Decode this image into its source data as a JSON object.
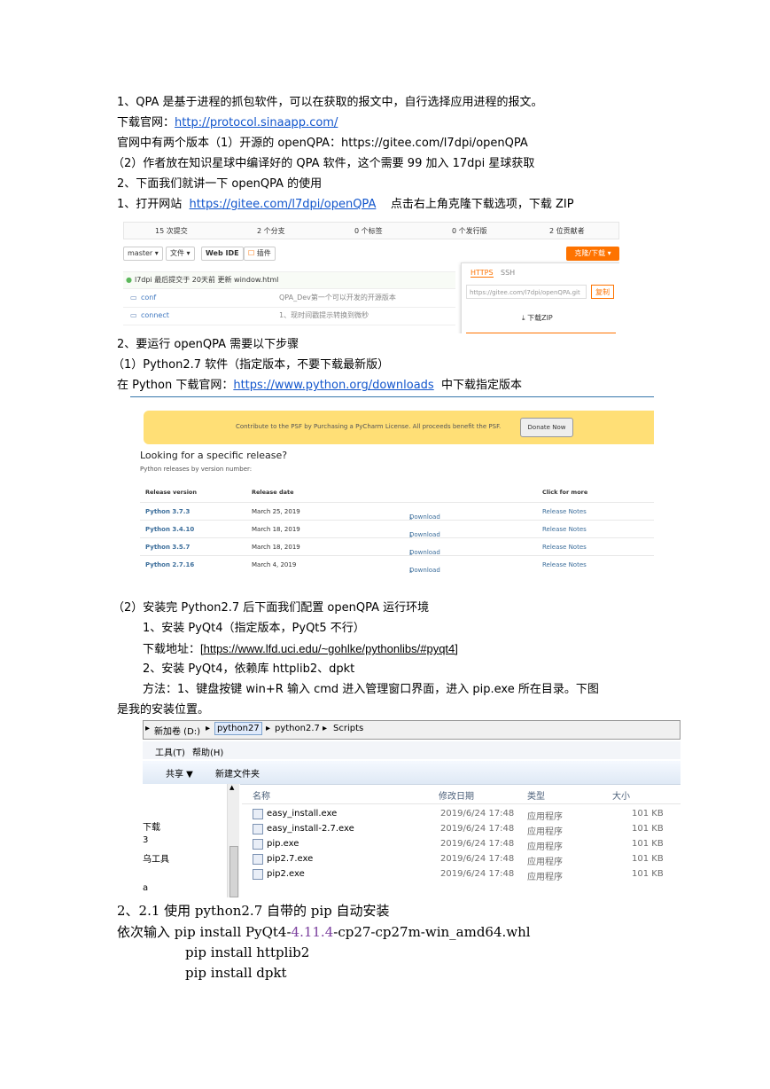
{
  "doc": {
    "l1": "1、QPA 是基于进程的抓包软件，可以在获取的报文中，自行选择应用进程的报文。",
    "l2_prefix": "下载官网：",
    "l2_link": "http://protocol.sinaapp.com/",
    "l3": "官网中有两个版本（1）开源的 openQPA：https://gitee.com/l7dpi/openQPA",
    "l4": "（2）作者放在知识星球中编译好的 QPA 软件，这个需要 99 加入 17dpi 星球获取",
    "l5": "2、下面我们就讲一下 openQPA 的使用",
    "l6_prefix": "1、打开网站",
    "l6_link": "https://gitee.com/l7dpi/openQPA",
    "l6_suffix": "点击右上角克隆下载选项，下载 ZIP",
    "l7": "2、要运行 openQPA 需要以下步骤",
    "l8": "（1）Python2.7 软件（指定版本，不要下载最新版）",
    "l9_prefix": "在 Python 下载官网：",
    "l9_link": "https://www.python.org/downloads",
    "l9_suffix": "中下载指定版本",
    "l10": "（2）安装完 Python2.7 后下面我们配置 openQPA 运行环境",
    "l11": "1、安装 PyQt4（指定版本，PyQt5 不行）",
    "l12_prefix": "下载地址：",
    "l12_link": "[https://www.lfd.uci.edu/~gohlke/pythonlibs/#pyqt4]",
    "l13": "2、安装 PyQt4，依赖库 httplib2、dpkt",
    "l14": "方法：1、键盘按键  win+R  输入 cmd 进入管理窗口界面，进入 pip.exe 所在目录。下图",
    "l15": "是我的安装位置。",
    "l16": "2、2.1 使用 python2.7 自带的 pip 自动安装",
    "l17_a": "依次输入 pip install PyQt4-",
    "l17_b": "4.11.4",
    "l17_c": "-cp27-cp27m-win_amd64.whl",
    "l18": "pip install httplib2",
    "l19": "pip install dpkt"
  },
  "gitee": {
    "stats": [
      "15 次提交",
      "2 个分支",
      "0 个标签",
      "0 个发行版",
      "2 位贡献者"
    ],
    "branch": "master ▾",
    "file_btn": "文件 ▾",
    "webide": "Web IDE",
    "plugin": "插件",
    "clone": "克隆/下载 ▾",
    "commit": "l7dpi 最后提交于 20天前 更新 window.html",
    "rows": [
      {
        "name": "conf",
        "msg": "QPA_Dev第一个可以开发的开源版本"
      },
      {
        "name": "connect",
        "msg": "1、现时间戳提示转换到微秒"
      }
    ],
    "tab_https": "HTTPS",
    "tab_ssh": "SSH",
    "url": "https://gitee.com/l7dpi/openQPA.git",
    "copy": "复制",
    "zip": "下载ZIP"
  },
  "python": {
    "banner": "Contribute to the PSF by Purchasing a PyCharm License. All proceeds benefit the PSF.",
    "donate": "Donate Now",
    "heading": "Looking for a specific release?",
    "sub": "Python releases by version number:",
    "headers": [
      "Release version",
      "Release date",
      "",
      "Click for more"
    ],
    "rows": [
      {
        "version": "Python 3.7.3",
        "date": "March 25, 2019",
        "dl": "Download",
        "notes": "Release Notes"
      },
      {
        "version": "Python 3.4.10",
        "date": "March 18, 2019",
        "dl": "Download",
        "notes": "Release Notes"
      },
      {
        "version": "Python 3.5.7",
        "date": "March 18, 2019",
        "dl": "Download",
        "notes": "Release Notes"
      },
      {
        "version": "Python 2.7.16",
        "date": "March 4, 2019",
        "dl": "Download",
        "notes": "Release Notes"
      }
    ]
  },
  "explorer": {
    "crumbs": [
      "新加卷 (D:)",
      "python27",
      "python2.7",
      "Scripts"
    ],
    "menu": [
      "工具(T)",
      "帮助(H)"
    ],
    "share": "共享 ▼",
    "new_folder": "新建文件夹",
    "cols": [
      "名称",
      "修改日期",
      "类型",
      "大小"
    ],
    "left": [
      "下载",
      "3",
      "乌工具",
      "a"
    ],
    "files": [
      {
        "name": "easy_install.exe",
        "date": "2019/6/24 17:48",
        "type": "应用程序",
        "size": "101 KB"
      },
      {
        "name": "easy_install-2.7.exe",
        "date": "2019/6/24 17:48",
        "type": "应用程序",
        "size": "101 KB"
      },
      {
        "name": "pip.exe",
        "date": "2019/6/24 17:48",
        "type": "应用程序",
        "size": "101 KB"
      },
      {
        "name": "pip2.7.exe",
        "date": "2019/6/24 17:48",
        "type": "应用程序",
        "size": "101 KB"
      },
      {
        "name": "pip2.exe",
        "date": "2019/6/24 17:48",
        "type": "应用程序",
        "size": "101 KB"
      }
    ]
  }
}
